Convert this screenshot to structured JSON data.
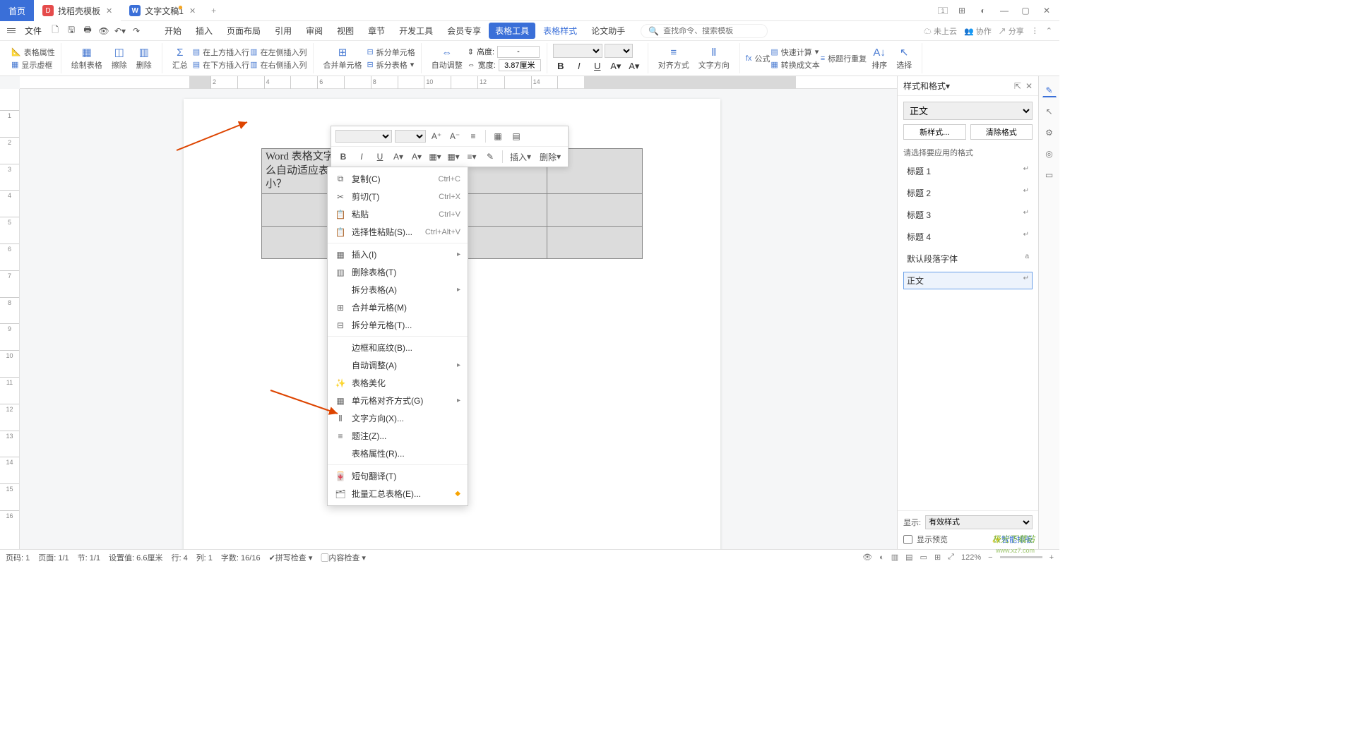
{
  "tabs": {
    "home": "首页",
    "shell": "找稻壳模板",
    "doc": "文字文稿1",
    "add": "+"
  },
  "menu": {
    "file": "文件",
    "items": [
      "开始",
      "插入",
      "页面布局",
      "引用",
      "审阅",
      "视图",
      "章节",
      "开发工具",
      "会员专享",
      "表格工具",
      "表格样式",
      "论文助手"
    ],
    "active_index": 9,
    "search_placeholder": "查找命令、搜索模板"
  },
  "mb_right": {
    "cloud": "未上云",
    "coop": "协作",
    "share": "分享"
  },
  "ribbon": {
    "g1_a": "表格属性",
    "g1_b": "显示虚框",
    "g2": [
      "绘制表格",
      "擦除",
      "删除"
    ],
    "g3": "汇总",
    "g4": [
      "在上方插入行",
      "在左侧插入列",
      "在下方插入行",
      "在右侧插入列"
    ],
    "g5": [
      "合并单元格",
      "拆分单元格",
      "拆分表格"
    ],
    "g6": "自动调整",
    "dim_h": "高度:",
    "dim_w": "宽度:",
    "dim_wv": "3.87厘米",
    "fmt": [
      "B",
      "I",
      "U",
      "A",
      "A"
    ],
    "g8": [
      "对齐方式",
      "文字方向"
    ],
    "g9a": "公式",
    "g9b": "快速计算",
    "g9c": "标题行重复",
    "g9d": "转换成文本",
    "g9e": "排序",
    "g9f": "选择"
  },
  "cell_text": "Word 表格文字么自动适应表小？",
  "float": {
    "insert": "插入",
    "delete": "删除"
  },
  "ctx": {
    "copy": "复制(C)",
    "copy_sc": "Ctrl+C",
    "cut": "剪切(T)",
    "cut_sc": "Ctrl+X",
    "paste": "粘贴",
    "paste_sc": "Ctrl+V",
    "spaste": "选择性粘贴(S)...",
    "spaste_sc": "Ctrl+Alt+V",
    "insert": "插入(I)",
    "deltable": "删除表格(T)",
    "splittable": "拆分表格(A)",
    "merge": "合并单元格(M)",
    "splitcell": "拆分单元格(T)...",
    "border": "边框和底纹(B)...",
    "autoadj": "自动调整(A)",
    "beauty": "表格美化",
    "align": "单元格对齐方式(G)",
    "textdir": "文字方向(X)...",
    "note": "题注(Z)...",
    "props": "表格属性(R)...",
    "trans": "短句翻译(T)",
    "batch": "批量汇总表格(E)..."
  },
  "stylepane": {
    "title": "样式和格式",
    "current": "正文",
    "new": "新样式...",
    "clear": "清除格式",
    "prompt": "请选择要应用的格式",
    "list": [
      "标题 1",
      "标题 2",
      "标题 3",
      "标题 4",
      "默认段落字体",
      "正文"
    ],
    "selected_index": 5,
    "show": "显示:",
    "show_val": "有效样式",
    "preview": "显示预览",
    "smart": "智能排版"
  },
  "status": {
    "pg": "页码: 1",
    "pgn": "页面: 1/1",
    "sec": "节: 1/1",
    "set": "设置值: 6.6厘米",
    "row": "行: 4",
    "col": "列: 1",
    "wc": "字数: 16/16",
    "spell": "拼写检查",
    "content": "内容检查",
    "zoom": "122%"
  },
  "watermark": {
    "a": "极光下载站",
    "b": "www.xz7.com"
  }
}
